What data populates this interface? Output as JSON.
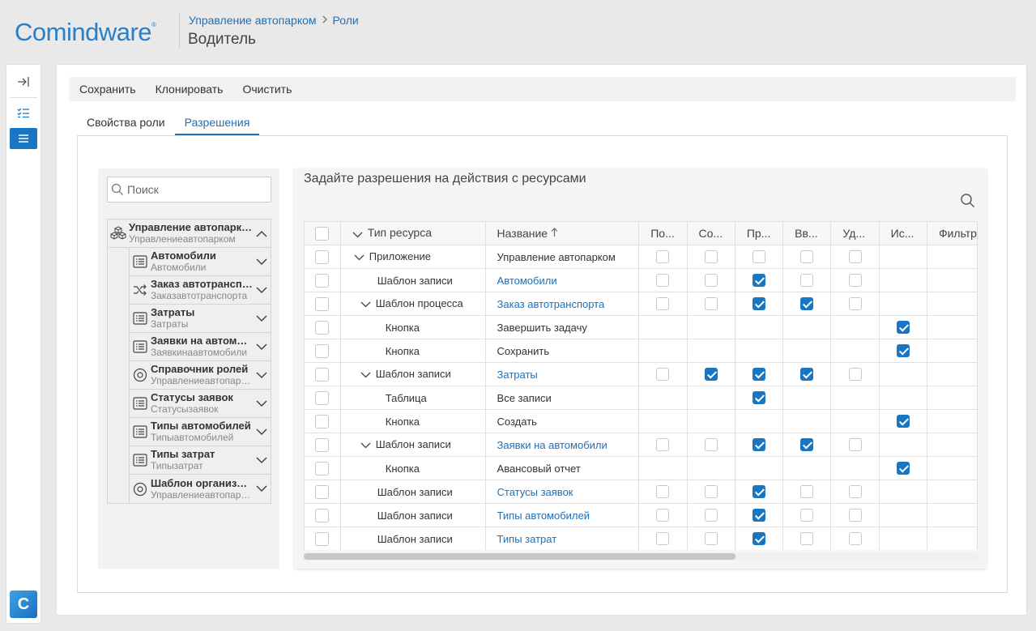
{
  "header": {
    "logo": "Comindware",
    "logo_mark": "®",
    "breadcrumb": [
      "Управление автопарком",
      "Роли"
    ],
    "title": "Водитель"
  },
  "toolbar": {
    "save": "Сохранить",
    "clone": "Клонировать",
    "clear": "Очистить"
  },
  "tabs": [
    {
      "label": "Свойства роли",
      "active": false
    },
    {
      "label": "Разрешения",
      "active": true
    }
  ],
  "tree_search": {
    "placeholder": "Поиск"
  },
  "tree": {
    "root": {
      "title": "Управление автопарком",
      "sub": "Управлениеавтопарком",
      "icon": "cubes-icon"
    },
    "children": [
      {
        "title": "Автомобили",
        "sub": "Автомобили",
        "icon": "list-icon"
      },
      {
        "title": "Заказ автотранспорта",
        "sub": "Заказавтотранспорта",
        "icon": "shuffle-icon"
      },
      {
        "title": "Затраты",
        "sub": "Затраты",
        "icon": "list-icon"
      },
      {
        "title": "Заявки на автомобили",
        "sub": "Заявкинаавтомобили",
        "icon": "list-icon"
      },
      {
        "title": "Справочник ролей",
        "sub": "Управлениеавтопарком",
        "icon": "circle-icon"
      },
      {
        "title": "Статусы заявок",
        "sub": "Статусызаявок",
        "icon": "list-icon"
      },
      {
        "title": "Типы автомобилей",
        "sub": "Типыавтомобилей",
        "icon": "list-icon"
      },
      {
        "title": "Типы затрат",
        "sub": "Типызатрат",
        "icon": "list-icon"
      },
      {
        "title": "Шаблон организации",
        "sub": "Управлениеавтопарком",
        "icon": "circle-icon"
      }
    ]
  },
  "permissions": {
    "title": "Задайте разрешения на действия с ресурсами",
    "columns": {
      "type": "Тип ресурса",
      "name": "Название",
      "perms": [
        "По...",
        "Со...",
        "Пр...",
        "Вв...",
        "Уд...",
        "Ис...",
        "Фильтр"
      ]
    },
    "rows": [
      {
        "type": "Приложение",
        "indent": 0,
        "caret": true,
        "name": "Управление автопарком",
        "link": false,
        "p": [
          0,
          0,
          0,
          0,
          0,
          null,
          null
        ]
      },
      {
        "type": "Шаблон записи",
        "indent": 1,
        "caret": false,
        "name": "Автомобили",
        "link": true,
        "p": [
          0,
          0,
          1,
          0,
          0,
          null,
          null
        ]
      },
      {
        "type": "Шаблон процесса",
        "indent": 1,
        "caret": true,
        "name": "Заказ автотранспорта",
        "link": true,
        "p": [
          0,
          0,
          1,
          1,
          0,
          null,
          null
        ]
      },
      {
        "type": "Кнопка",
        "indent": 2,
        "caret": false,
        "name": "Завершить задачу",
        "link": false,
        "p": [
          null,
          null,
          null,
          null,
          null,
          1,
          null
        ]
      },
      {
        "type": "Кнопка",
        "indent": 2,
        "caret": false,
        "name": "Сохранить",
        "link": false,
        "p": [
          null,
          null,
          null,
          null,
          null,
          1,
          null
        ]
      },
      {
        "type": "Шаблон записи",
        "indent": 1,
        "caret": true,
        "name": "Затраты",
        "link": true,
        "p": [
          0,
          1,
          1,
          1,
          0,
          null,
          null
        ]
      },
      {
        "type": "Таблица",
        "indent": 2,
        "caret": false,
        "name": "Все записи",
        "link": false,
        "p": [
          null,
          null,
          1,
          null,
          null,
          null,
          null
        ]
      },
      {
        "type": "Кнопка",
        "indent": 2,
        "caret": false,
        "name": "Создать",
        "link": false,
        "p": [
          null,
          null,
          null,
          null,
          null,
          1,
          null
        ]
      },
      {
        "type": "Шаблон записи",
        "indent": 1,
        "caret": true,
        "name": "Заявки на автомобили",
        "link": true,
        "p": [
          0,
          0,
          1,
          1,
          0,
          null,
          null
        ]
      },
      {
        "type": "Кнопка",
        "indent": 2,
        "caret": false,
        "name": "Авансовый отчет",
        "link": false,
        "p": [
          null,
          null,
          null,
          null,
          null,
          1,
          null
        ]
      },
      {
        "type": "Шаблон записи",
        "indent": 1,
        "caret": false,
        "name": "Статусы заявок",
        "link": true,
        "p": [
          0,
          0,
          1,
          0,
          0,
          null,
          null
        ]
      },
      {
        "type": "Шаблон записи",
        "indent": 1,
        "caret": false,
        "name": "Типы автомобилей",
        "link": true,
        "p": [
          0,
          0,
          1,
          0,
          0,
          null,
          null
        ]
      },
      {
        "type": "Шаблон записи",
        "indent": 1,
        "caret": false,
        "name": "Типы затрат",
        "link": true,
        "p": [
          0,
          0,
          1,
          0,
          0,
          null,
          null
        ]
      }
    ]
  },
  "colors": {
    "accent": "#1976c2",
    "link": "#1f6fb5",
    "logo": "#2a7fc6"
  }
}
